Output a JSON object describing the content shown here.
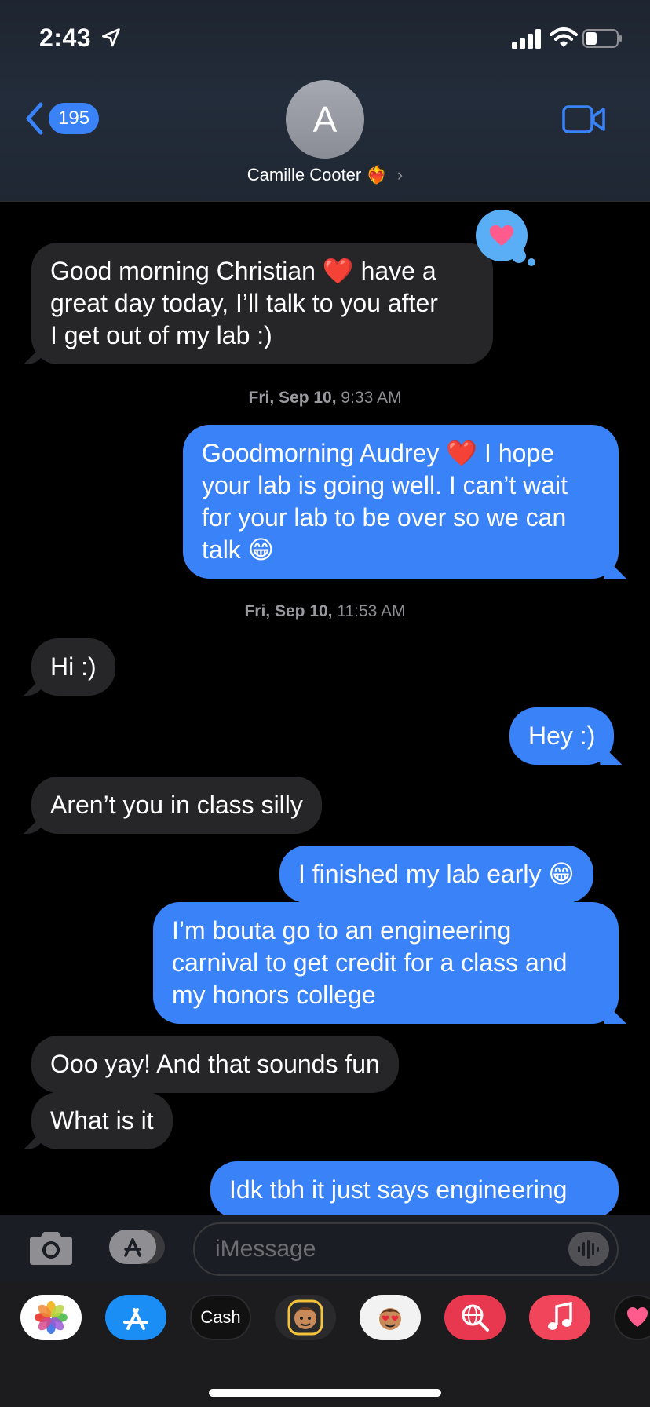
{
  "status_bar": {
    "time": "2:43"
  },
  "header": {
    "back_count": "195",
    "avatar_initial": "A",
    "contact_name": "Camille Cooter",
    "contact_emoji": "❤️‍🔥",
    "chevron": "›"
  },
  "messages": [
    {
      "type": "received",
      "text": "Good morning Christian ❤️ have a\ngreat day today, I’ll talk to you after\nI get out of my lab :)"
    },
    {
      "type": "timestamp",
      "day": "Fri, Sep 10,",
      "time": "9:33 AM"
    },
    {
      "type": "sent",
      "text": "Goodmorning Audrey ❤️ I hope\nyour lab is going well. I can’t wait\nfor your lab to be over so we can\ntalk 😁"
    },
    {
      "type": "timestamp",
      "day": "Fri, Sep 10,",
      "time": "11:53 AM"
    },
    {
      "type": "received",
      "text": "Hi :)"
    },
    {
      "type": "sent",
      "text": "Hey :)"
    },
    {
      "type": "received",
      "text": "Aren’t you in class silly"
    },
    {
      "type": "sent",
      "text": "I finished my lab early 😁"
    },
    {
      "type": "sent",
      "text": "I’m bouta go to an engineering\ncarnival to get credit for a class and\nmy honors college"
    },
    {
      "type": "received",
      "text": "Ooo yay! And that sounds fun"
    },
    {
      "type": "received",
      "text": "What is it"
    },
    {
      "type": "sent",
      "text": "Idk tbh it just says engineering"
    }
  ],
  "tapback": {
    "icon": "heart-icon",
    "color": "#5aaef5"
  },
  "input": {
    "placeholder": "iMessage"
  },
  "drawer": {
    "apps": [
      {
        "name": "photos-app-icon",
        "label": ""
      },
      {
        "name": "app-store-app-icon",
        "label": ""
      },
      {
        "name": "apple-cash-app-icon",
        "label": "Cash"
      },
      {
        "name": "memoji-app-icon",
        "label": ""
      },
      {
        "name": "memoji-stickers-app-icon",
        "label": ""
      },
      {
        "name": "web-images-app-icon",
        "label": ""
      },
      {
        "name": "music-app-icon",
        "label": ""
      },
      {
        "name": "more-app-icon",
        "label": ""
      }
    ]
  },
  "colors": {
    "sent_bubble": "#3a82f7",
    "received_bubble": "#262628",
    "background": "#000000",
    "accent": "#3a82f7"
  }
}
